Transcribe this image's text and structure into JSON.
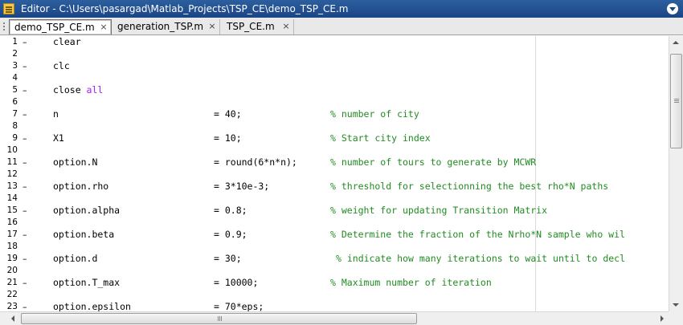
{
  "window": {
    "title": "Editor - C:\\Users\\pasargad\\Matlab_Projects\\TSP_CE\\demo_TSP_CE.m"
  },
  "tabs": [
    {
      "label": "demo_TSP_CE.m",
      "close": "×",
      "active": true
    },
    {
      "label": "generation_TSP.m",
      "close": "×",
      "active": false
    },
    {
      "label": "TSP_CE.m",
      "close": "×",
      "active": false
    }
  ],
  "colors": {
    "code": "#000000",
    "keyword": "#a020f0",
    "comment": "#228b22",
    "titlebar": "#1b4585"
  },
  "editor": {
    "lines": [
      {
        "num": "1",
        "dash": "–",
        "code": "clear"
      },
      {
        "num": "2",
        "dash": "",
        "code": ""
      },
      {
        "num": "3",
        "dash": "–",
        "code": "clc"
      },
      {
        "num": "4",
        "dash": "",
        "code": ""
      },
      {
        "num": "5",
        "dash": "–",
        "code": "close ",
        "kw": "all"
      },
      {
        "num": "6",
        "dash": "",
        "code": ""
      },
      {
        "num": "7",
        "dash": "–",
        "code": "n",
        "val": "= 40;",
        "comment": "% number of city"
      },
      {
        "num": "8",
        "dash": "",
        "code": ""
      },
      {
        "num": "9",
        "dash": "–",
        "code": "X1",
        "val": "= 10;",
        "comment": "% Start city index"
      },
      {
        "num": "10",
        "dash": "",
        "code": ""
      },
      {
        "num": "11",
        "dash": "–",
        "code": "option.N",
        "val": "= round(6*n*n);",
        "comment": "% number of tours to generate by MCWR"
      },
      {
        "num": "12",
        "dash": "",
        "code": ""
      },
      {
        "num": "13",
        "dash": "–",
        "code": "option.rho",
        "val": "= 3*10e-3;",
        "comment": "% threshold for selectionning the best rho*N paths"
      },
      {
        "num": "14",
        "dash": "",
        "code": ""
      },
      {
        "num": "15",
        "dash": "–",
        "code": "option.alpha",
        "val": "= 0.8;",
        "comment": "% weight for updating Transition Matrix"
      },
      {
        "num": "16",
        "dash": "",
        "code": ""
      },
      {
        "num": "17",
        "dash": "–",
        "code": "option.beta",
        "val": "= 0.9;",
        "comment": "% Determine the fraction of the Nrho*N sample who wil"
      },
      {
        "num": "18",
        "dash": "",
        "code": ""
      },
      {
        "num": "19",
        "dash": "–",
        "code": "option.d",
        "val": "= 30;",
        "comment": "% indicate how many iterations to wait until to decl",
        "comment_offset": true
      },
      {
        "num": "20",
        "dash": "",
        "code": ""
      },
      {
        "num": "21",
        "dash": "–",
        "code": "option.T_max",
        "val": "= 10000;",
        "comment": "% Maximum number of iteration"
      },
      {
        "num": "22",
        "dash": "",
        "code": ""
      },
      {
        "num": "23",
        "dash": "–",
        "code": "option.epsilon",
        "val": "= 70*eps;"
      }
    ]
  }
}
